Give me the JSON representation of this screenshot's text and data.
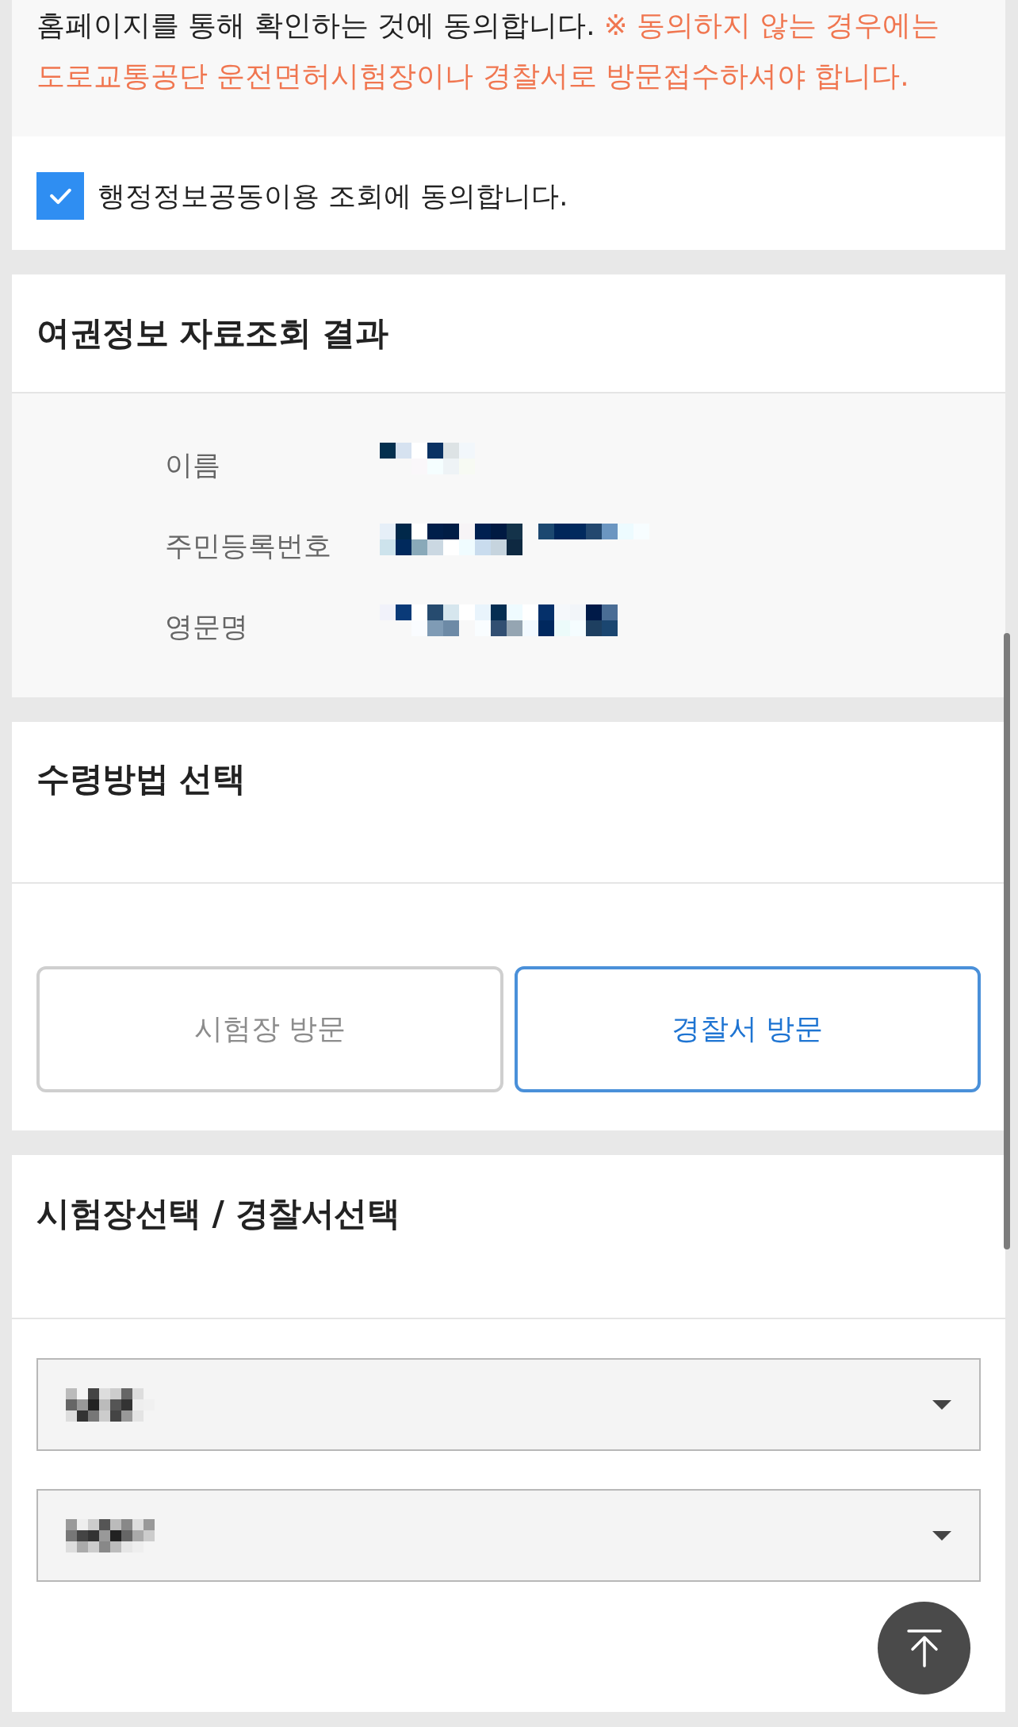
{
  "consent": {
    "text": "홈페이지를 통해 확인하는 것에 동의합니다.",
    "warning": "※ 동의하지 않는 경우에는 도로교통공단 운전면허시험장이나 경찰서로 방문접수하셔야 합니다."
  },
  "agreement": {
    "label": "행정정보공동이용 조회에 동의합니다.",
    "checked": true
  },
  "passport_info": {
    "title": "여권정보 자료조회 결과",
    "rows": [
      {
        "label": "이름",
        "redacted": true
      },
      {
        "label": "주민등록번호",
        "redacted": true
      },
      {
        "label": "영문명",
        "redacted": true
      }
    ]
  },
  "receipt_method": {
    "title": "수령방법 선택",
    "options": [
      {
        "label": "시험장 방문",
        "selected": false
      },
      {
        "label": "경찰서 방문",
        "selected": true
      }
    ]
  },
  "office_select": {
    "title": "시험장선택 / 경찰서선택",
    "dropdowns": [
      {
        "redacted": true
      },
      {
        "redacted": true
      }
    ]
  }
}
